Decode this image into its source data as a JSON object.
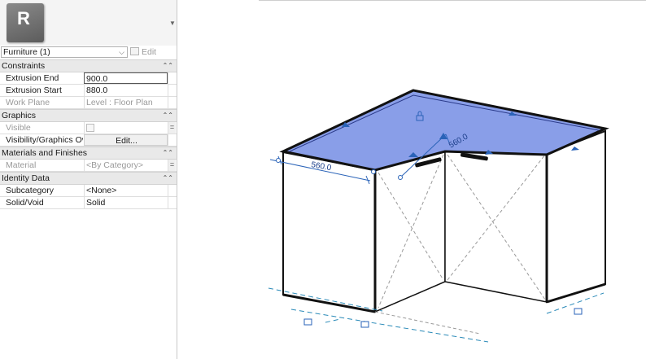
{
  "type_selector": {
    "logo_letter": "R"
  },
  "filter": {
    "value": "Furniture (1)"
  },
  "edit_type": {
    "label": "Edit Type"
  },
  "groups": {
    "constraints": "Constraints",
    "graphics": "Graphics",
    "materials": "Materials and Finishes",
    "identity": "Identity Data"
  },
  "props": {
    "extrusion_end": {
      "label": "Extrusion End",
      "value": "900.0"
    },
    "extrusion_start": {
      "label": "Extrusion Start",
      "value": "880.0"
    },
    "work_plane": {
      "label": "Work Plane",
      "value": "Level : Floor Plan"
    },
    "visible": {
      "label": "Visible"
    },
    "vis_graphics": {
      "label": "Visibility/Graphics Ov...",
      "value": "Edit..."
    },
    "material": {
      "label": "Material",
      "value": "<By Category>"
    },
    "subcategory": {
      "label": "Subcategory",
      "value": "<None>"
    },
    "solid_void": {
      "label": "Solid/Void",
      "value": "Solid"
    }
  },
  "dimensions": {
    "left_width": "560.0",
    "front_width": "560.0"
  },
  "colors": {
    "selection_fill": "#7f96e6",
    "accent_blue": "#2a63b8"
  }
}
